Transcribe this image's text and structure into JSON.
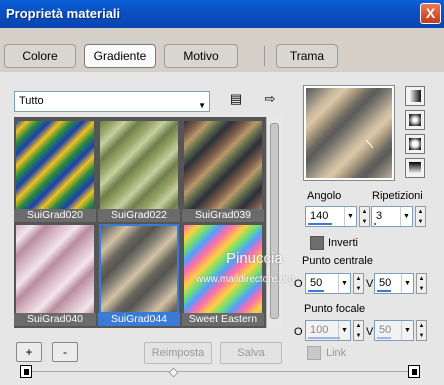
{
  "window": {
    "title": "Proprietà materiali",
    "close_label": "X"
  },
  "tabs": [
    {
      "label": "Colore"
    },
    {
      "label": "Gradiente",
      "active": true
    },
    {
      "label": "Motivo"
    },
    {
      "label": "Trama"
    }
  ],
  "library": {
    "category_value": "Tutto",
    "items": [
      {
        "name": "SuiGrad020",
        "gradient": "repeating-linear-gradient(135deg,#1a3fb0 0,#f0c020 8px,#2a8a40 16px,#1a3fb0 24px)"
      },
      {
        "name": "SuiGrad022",
        "gradient": "repeating-linear-gradient(135deg,#6f7e4a 0,#9aa86a 10px,#c7cfa0 18px,#6f7e4a 28px)"
      },
      {
        "name": "SuiGrad039",
        "gradient": "repeating-linear-gradient(135deg,#2d2f3a 0,#7a5a4a 10px,#b99a6a 18px,#5a6a4a 26px,#2d2f3a 34px)"
      },
      {
        "name": "SuiGrad040",
        "gradient": "repeating-linear-gradient(135deg,#d6b6c4 0,#f3e4ea 12px,#b88c9c 22px,#d6b6c4 32px)"
      },
      {
        "name": "SuiGrad044",
        "gradient": "repeating-linear-gradient(135deg,#555550 0,#8a857a 10px,#d2c2a4 20px,#6a665e 32px,#555550 40px)",
        "selected": true
      },
      {
        "name": "Sweet Eastern",
        "gradient": "repeating-linear-gradient(135deg,#ff6ab0 0,#ffd040 10px,#70e070 18px,#50a0ff 26px,#ff6ab0 34px)"
      }
    ]
  },
  "controls": {
    "angolo_label": "Angolo",
    "angolo_value": "140",
    "ripetizioni_label": "Ripetizioni",
    "ripetizioni_value": "3",
    "inverti_label": "Inverti",
    "punto_centrale_label": "Punto centrale",
    "centrale_o_label": "O",
    "centrale_o_value": "50",
    "centrale_v_label": "V",
    "centrale_v_value": "50",
    "punto_focale_label": "Punto focale",
    "focale_o_label": "O",
    "focale_o_value": "100",
    "focale_v_label": "V",
    "focale_v_value": "50",
    "link_label": "Link"
  },
  "buttons": {
    "add": "+",
    "remove": "-",
    "reset": "Reimposta",
    "save": "Salva"
  },
  "watermark": {
    "line1": "Pinuccia",
    "line2": "www.maildirectore.org"
  }
}
